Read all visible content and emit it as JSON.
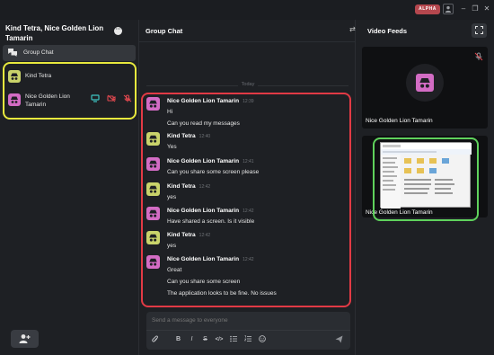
{
  "titlebar": {
    "badge": "ALPHA"
  },
  "sidebar": {
    "title": "Kind Tetra, Nice Golden Lion Tamarin",
    "group_chat_label": "Group Chat",
    "members": [
      {
        "name": "Kind Tetra",
        "avatar_color": "#c9d36a"
      },
      {
        "name": "Nice Golden Lion Tamarin",
        "avatar_color": "#d36cc4"
      }
    ]
  },
  "chat": {
    "title": "Group Chat",
    "date_divider": "Today",
    "messages": [
      {
        "sender": "Nice Golden Lion Tamarin",
        "time": "12:39",
        "avatar_color": "#d36cc4",
        "lines": [
          "Hi",
          "Can you read my messages"
        ]
      },
      {
        "sender": "Kind Tetra",
        "time": "12:40",
        "avatar_color": "#c9d36a",
        "lines": [
          "Yes"
        ]
      },
      {
        "sender": "Nice Golden Lion Tamarin",
        "time": "12:41",
        "avatar_color": "#d36cc4",
        "lines": [
          "Can you share some screen please"
        ]
      },
      {
        "sender": "Kind Tetra",
        "time": "12:42",
        "avatar_color": "#c9d36a",
        "lines": [
          "yes"
        ]
      },
      {
        "sender": "Nice Golden Lion Tamarin",
        "time": "12:42",
        "avatar_color": "#d36cc4",
        "lines": [
          "Have shared a screen. Is it visible"
        ]
      },
      {
        "sender": "Kind Tetra",
        "time": "12:42",
        "avatar_color": "#c9d36a",
        "lines": [
          "yes"
        ]
      },
      {
        "sender": "Nice Golden Lion Tamarin",
        "time": "12:42",
        "avatar_color": "#d36cc4",
        "lines": [
          "Great",
          "Can you share some screen",
          "The application looks to be fine. No issues"
        ]
      }
    ],
    "input_placeholder": "Send a message to everyone"
  },
  "feeds": {
    "title": "Video Feeds",
    "tiles": [
      {
        "name": "Nice Golden Lion Tamarin"
      },
      {
        "name": "Nice Golden Lion Tamarin"
      }
    ]
  },
  "colors": {
    "highlight_members": "#e7e83d",
    "highlight_messages": "#e23a45",
    "highlight_screen": "#5fd25c",
    "badge": "#b5474e"
  }
}
